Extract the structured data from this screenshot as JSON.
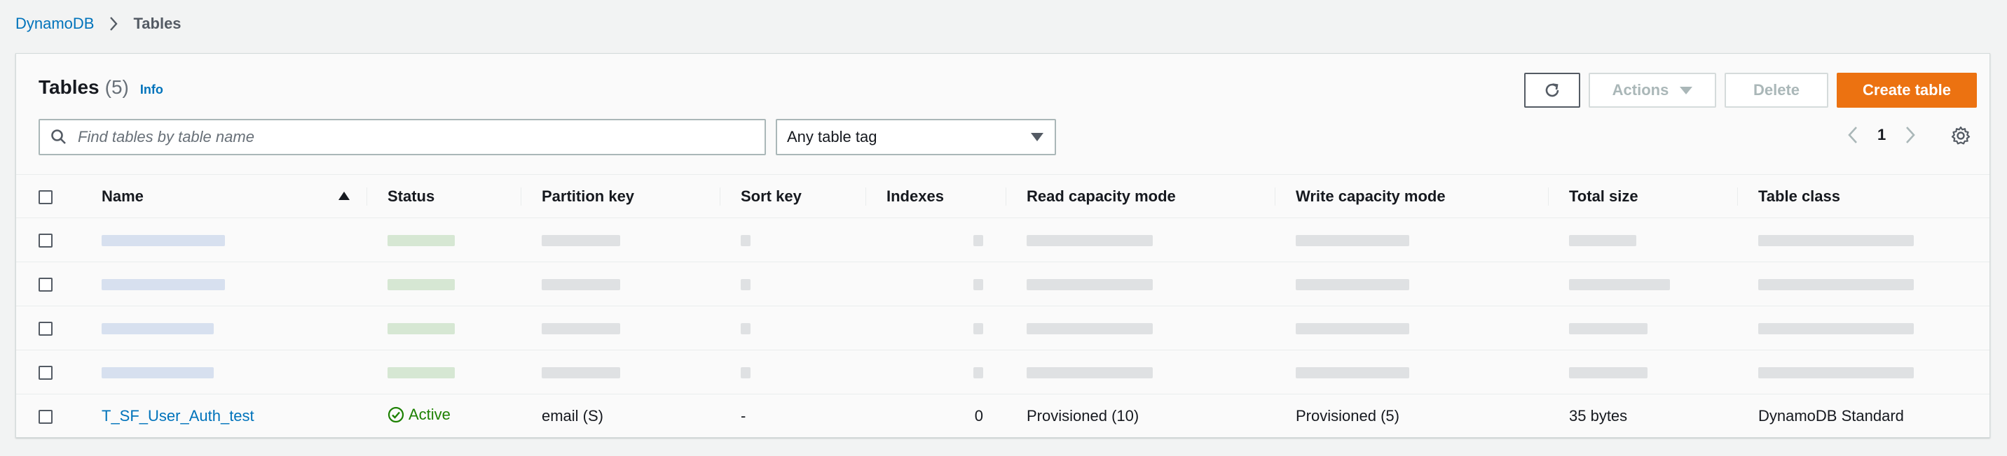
{
  "breadcrumb": {
    "root": "DynamoDB",
    "current": "Tables"
  },
  "panel": {
    "title": "Tables",
    "count": "(5)",
    "info": "Info"
  },
  "toolbar": {
    "actions_label": "Actions",
    "delete_label": "Delete",
    "create_label": "Create table"
  },
  "search": {
    "placeholder": "Find tables by table name"
  },
  "tag_filter": {
    "selected": "Any table tag"
  },
  "pagination": {
    "page": "1"
  },
  "table": {
    "columns": {
      "name": "Name",
      "status": "Status",
      "partition_key": "Partition key",
      "sort_key": "Sort key",
      "indexes": "Indexes",
      "read_capacity": "Read capacity mode",
      "write_capacity": "Write capacity mode",
      "total_size": "Total size",
      "table_class": "Table class"
    },
    "visible_row": {
      "name": "T_SF_User_Auth_test",
      "status": "Active",
      "partition_key": "email (S)",
      "sort_key": "-",
      "indexes": "0",
      "read_capacity": "Provisioned (10)",
      "write_capacity": "Provisioned (5)",
      "total_size": "35 bytes",
      "table_class": "DynamoDB Standard"
    }
  },
  "colors": {
    "link": "#0073bb",
    "primary_button": "#ec7211",
    "active_status": "#1d8102"
  },
  "icons": {
    "breadcrumb_separator": "chevron-right-icon",
    "refresh": "refresh-icon",
    "search": "search-icon",
    "settings": "gear-icon",
    "status_active": "check-circle-icon"
  }
}
